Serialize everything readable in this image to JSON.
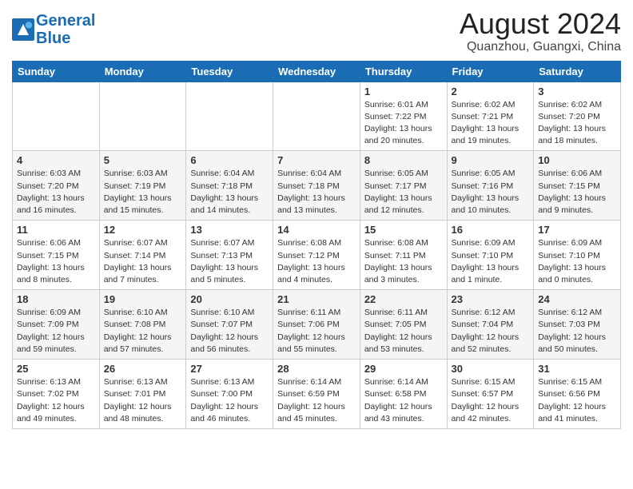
{
  "header": {
    "logo_line1": "General",
    "logo_line2": "Blue",
    "month": "August 2024",
    "location": "Quanzhou, Guangxi, China"
  },
  "weekdays": [
    "Sunday",
    "Monday",
    "Tuesday",
    "Wednesday",
    "Thursday",
    "Friday",
    "Saturday"
  ],
  "weeks": [
    [
      {
        "day": "",
        "info": ""
      },
      {
        "day": "",
        "info": ""
      },
      {
        "day": "",
        "info": ""
      },
      {
        "day": "",
        "info": ""
      },
      {
        "day": "1",
        "info": "Sunrise: 6:01 AM\nSunset: 7:22 PM\nDaylight: 13 hours\nand 20 minutes."
      },
      {
        "day": "2",
        "info": "Sunrise: 6:02 AM\nSunset: 7:21 PM\nDaylight: 13 hours\nand 19 minutes."
      },
      {
        "day": "3",
        "info": "Sunrise: 6:02 AM\nSunset: 7:20 PM\nDaylight: 13 hours\nand 18 minutes."
      }
    ],
    [
      {
        "day": "4",
        "info": "Sunrise: 6:03 AM\nSunset: 7:20 PM\nDaylight: 13 hours\nand 16 minutes."
      },
      {
        "day": "5",
        "info": "Sunrise: 6:03 AM\nSunset: 7:19 PM\nDaylight: 13 hours\nand 15 minutes."
      },
      {
        "day": "6",
        "info": "Sunrise: 6:04 AM\nSunset: 7:18 PM\nDaylight: 13 hours\nand 14 minutes."
      },
      {
        "day": "7",
        "info": "Sunrise: 6:04 AM\nSunset: 7:18 PM\nDaylight: 13 hours\nand 13 minutes."
      },
      {
        "day": "8",
        "info": "Sunrise: 6:05 AM\nSunset: 7:17 PM\nDaylight: 13 hours\nand 12 minutes."
      },
      {
        "day": "9",
        "info": "Sunrise: 6:05 AM\nSunset: 7:16 PM\nDaylight: 13 hours\nand 10 minutes."
      },
      {
        "day": "10",
        "info": "Sunrise: 6:06 AM\nSunset: 7:15 PM\nDaylight: 13 hours\nand 9 minutes."
      }
    ],
    [
      {
        "day": "11",
        "info": "Sunrise: 6:06 AM\nSunset: 7:15 PM\nDaylight: 13 hours\nand 8 minutes."
      },
      {
        "day": "12",
        "info": "Sunrise: 6:07 AM\nSunset: 7:14 PM\nDaylight: 13 hours\nand 7 minutes."
      },
      {
        "day": "13",
        "info": "Sunrise: 6:07 AM\nSunset: 7:13 PM\nDaylight: 13 hours\nand 5 minutes."
      },
      {
        "day": "14",
        "info": "Sunrise: 6:08 AM\nSunset: 7:12 PM\nDaylight: 13 hours\nand 4 minutes."
      },
      {
        "day": "15",
        "info": "Sunrise: 6:08 AM\nSunset: 7:11 PM\nDaylight: 13 hours\nand 3 minutes."
      },
      {
        "day": "16",
        "info": "Sunrise: 6:09 AM\nSunset: 7:10 PM\nDaylight: 13 hours\nand 1 minute."
      },
      {
        "day": "17",
        "info": "Sunrise: 6:09 AM\nSunset: 7:10 PM\nDaylight: 13 hours\nand 0 minutes."
      }
    ],
    [
      {
        "day": "18",
        "info": "Sunrise: 6:09 AM\nSunset: 7:09 PM\nDaylight: 12 hours\nand 59 minutes."
      },
      {
        "day": "19",
        "info": "Sunrise: 6:10 AM\nSunset: 7:08 PM\nDaylight: 12 hours\nand 57 minutes."
      },
      {
        "day": "20",
        "info": "Sunrise: 6:10 AM\nSunset: 7:07 PM\nDaylight: 12 hours\nand 56 minutes."
      },
      {
        "day": "21",
        "info": "Sunrise: 6:11 AM\nSunset: 7:06 PM\nDaylight: 12 hours\nand 55 minutes."
      },
      {
        "day": "22",
        "info": "Sunrise: 6:11 AM\nSunset: 7:05 PM\nDaylight: 12 hours\nand 53 minutes."
      },
      {
        "day": "23",
        "info": "Sunrise: 6:12 AM\nSunset: 7:04 PM\nDaylight: 12 hours\nand 52 minutes."
      },
      {
        "day": "24",
        "info": "Sunrise: 6:12 AM\nSunset: 7:03 PM\nDaylight: 12 hours\nand 50 minutes."
      }
    ],
    [
      {
        "day": "25",
        "info": "Sunrise: 6:13 AM\nSunset: 7:02 PM\nDaylight: 12 hours\nand 49 minutes."
      },
      {
        "day": "26",
        "info": "Sunrise: 6:13 AM\nSunset: 7:01 PM\nDaylight: 12 hours\nand 48 minutes."
      },
      {
        "day": "27",
        "info": "Sunrise: 6:13 AM\nSunset: 7:00 PM\nDaylight: 12 hours\nand 46 minutes."
      },
      {
        "day": "28",
        "info": "Sunrise: 6:14 AM\nSunset: 6:59 PM\nDaylight: 12 hours\nand 45 minutes."
      },
      {
        "day": "29",
        "info": "Sunrise: 6:14 AM\nSunset: 6:58 PM\nDaylight: 12 hours\nand 43 minutes."
      },
      {
        "day": "30",
        "info": "Sunrise: 6:15 AM\nSunset: 6:57 PM\nDaylight: 12 hours\nand 42 minutes."
      },
      {
        "day": "31",
        "info": "Sunrise: 6:15 AM\nSunset: 6:56 PM\nDaylight: 12 hours\nand 41 minutes."
      }
    ]
  ]
}
